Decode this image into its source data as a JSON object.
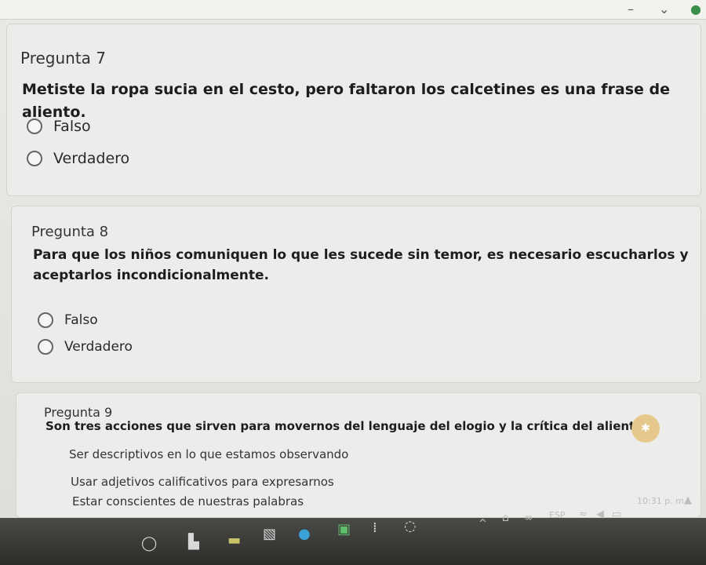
{
  "questions": [
    {
      "number": "Pregunta 7",
      "text": "Metiste la ropa sucia en el cesto, pero faltaron los calcetines es una frase de aliento.",
      "options": [
        "Falso",
        "Verdadero"
      ]
    },
    {
      "number": "Pregunta 8",
      "text": "Para que los niños comuniquen lo que les sucede sin temor, es necesario escucharlos y aceptarlos incondicionalmente.",
      "options": [
        "Falso",
        "Verdadero"
      ]
    },
    {
      "number": "Pregunta 9",
      "text": "Son tres acciones que sirven para movernos del lenguaje del elogio y la crítica del aliento.",
      "options": [
        "Ser descriptivos en lo que estamos observando",
        "Usar adjetivos calificativos para expresarnos",
        "Estar conscientes de nuestras palabras"
      ]
    }
  ],
  "taskbar": {
    "language": "ESP",
    "clock": "10:31 p. m."
  },
  "colors": {
    "taskbar": "#2c2c2a",
    "badge": "#e6c88c"
  }
}
